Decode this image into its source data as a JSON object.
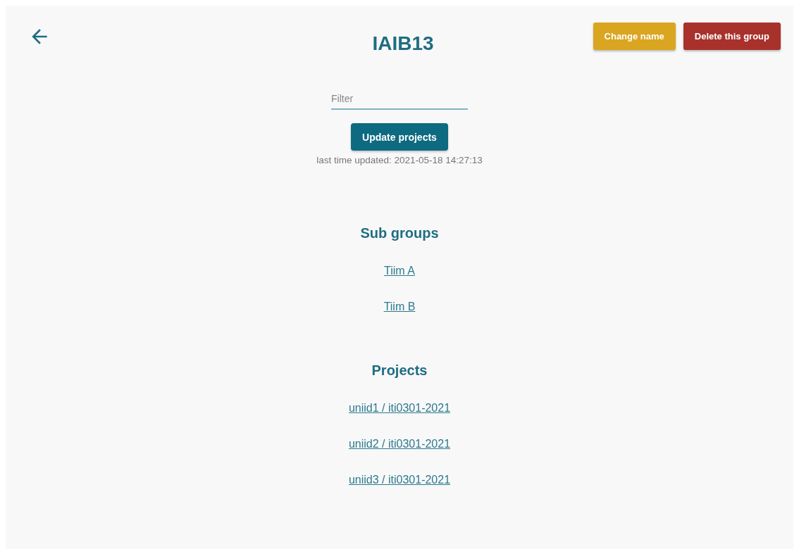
{
  "title": "IAIB13",
  "actions": [
    {
      "label": "Change name",
      "kind": "warning"
    },
    {
      "label": "Delete this group",
      "kind": "danger"
    }
  ],
  "filter": {
    "placeholder": "Filter"
  },
  "update_button": "Update projects",
  "last_updated": "last time updated: 2021-05-18 14:27:13",
  "sections": [
    {
      "heading": "Sub groups",
      "links": [
        "Tiim A",
        "Tiim B"
      ]
    },
    {
      "heading": "Projects",
      "links": [
        "uniid1 / iti0301-2021",
        "uniid2 / iti0301-2021",
        "uniid3 / iti0301-2021"
      ]
    }
  ]
}
